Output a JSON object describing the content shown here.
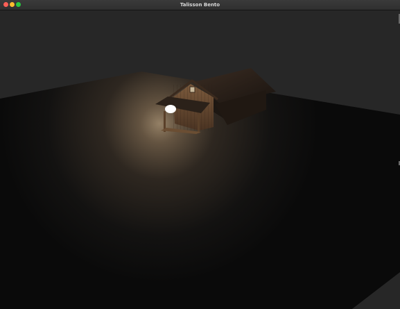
{
  "window": {
    "title": "Talisson Bento"
  },
  "scene": {
    "description_icons": [
      "ground-plane",
      "cabin-model",
      "point-light-sphere"
    ],
    "colors": {
      "background": "#272727",
      "ground_dark": "#0b0b0b",
      "light_glow": "#fff8e6",
      "light_sphere": "#ffffff"
    }
  }
}
